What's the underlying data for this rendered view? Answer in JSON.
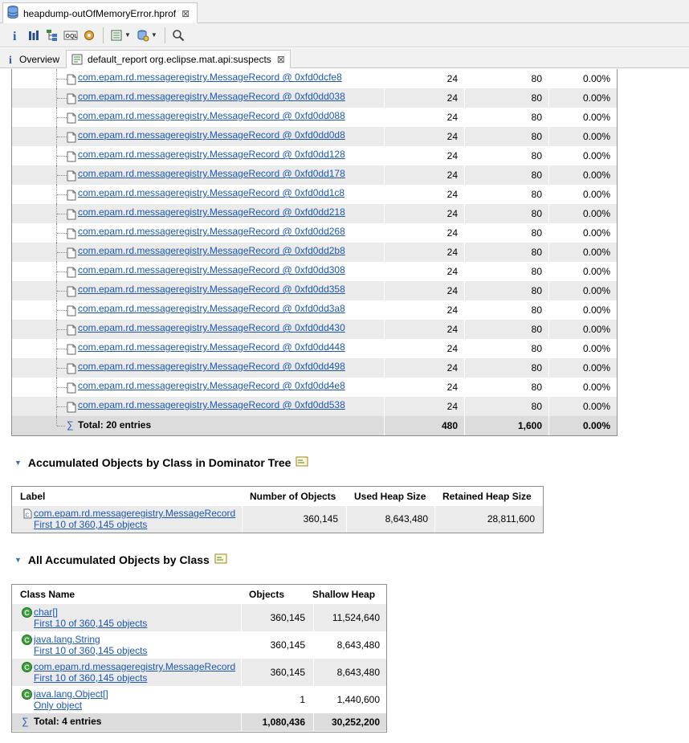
{
  "editor_tab": {
    "title": "heapdump-outOfMemoryError.hprof",
    "close": "⊠"
  },
  "toolbar": {
    "buttons": [
      "info-icon",
      "histogram-icon",
      "dominator-tree-icon",
      "oql-icon",
      "heap-dump-overview-icon",
      "query-browser-icon",
      "find-object-icon",
      "search-icon"
    ]
  },
  "inner_tabs": {
    "overview_label": "Overview",
    "report_label": "default_report  org.eclipse.mat.api:suspects",
    "report_close": "⊠"
  },
  "record_table": {
    "rows": [
      {
        "object": "com.epam.rd.messageregistry.MessageRecord @ 0xfd0dcfe8",
        "shallow": "24",
        "retained": "80",
        "percent": "0.00%"
      },
      {
        "object": "com.epam.rd.messageregistry.MessageRecord @ 0xfd0dd038",
        "shallow": "24",
        "retained": "80",
        "percent": "0.00%"
      },
      {
        "object": "com.epam.rd.messageregistry.MessageRecord @ 0xfd0dd088",
        "shallow": "24",
        "retained": "80",
        "percent": "0.00%"
      },
      {
        "object": "com.epam.rd.messageregistry.MessageRecord @ 0xfd0dd0d8",
        "shallow": "24",
        "retained": "80",
        "percent": "0.00%"
      },
      {
        "object": "com.epam.rd.messageregistry.MessageRecord @ 0xfd0dd128",
        "shallow": "24",
        "retained": "80",
        "percent": "0.00%"
      },
      {
        "object": "com.epam.rd.messageregistry.MessageRecord @ 0xfd0dd178",
        "shallow": "24",
        "retained": "80",
        "percent": "0.00%"
      },
      {
        "object": "com.epam.rd.messageregistry.MessageRecord @ 0xfd0dd1c8",
        "shallow": "24",
        "retained": "80",
        "percent": "0.00%"
      },
      {
        "object": "com.epam.rd.messageregistry.MessageRecord @ 0xfd0dd218",
        "shallow": "24",
        "retained": "80",
        "percent": "0.00%"
      },
      {
        "object": "com.epam.rd.messageregistry.MessageRecord @ 0xfd0dd268",
        "shallow": "24",
        "retained": "80",
        "percent": "0.00%"
      },
      {
        "object": "com.epam.rd.messageregistry.MessageRecord @ 0xfd0dd2b8",
        "shallow": "24",
        "retained": "80",
        "percent": "0.00%"
      },
      {
        "object": "com.epam.rd.messageregistry.MessageRecord @ 0xfd0dd308",
        "shallow": "24",
        "retained": "80",
        "percent": "0.00%"
      },
      {
        "object": "com.epam.rd.messageregistry.MessageRecord @ 0xfd0dd358",
        "shallow": "24",
        "retained": "80",
        "percent": "0.00%"
      },
      {
        "object": "com.epam.rd.messageregistry.MessageRecord @ 0xfd0dd3a8",
        "shallow": "24",
        "retained": "80",
        "percent": "0.00%"
      },
      {
        "object": "com.epam.rd.messageregistry.MessageRecord @ 0xfd0dd430",
        "shallow": "24",
        "retained": "80",
        "percent": "0.00%"
      },
      {
        "object": "com.epam.rd.messageregistry.MessageRecord @ 0xfd0dd448",
        "shallow": "24",
        "retained": "80",
        "percent": "0.00%"
      },
      {
        "object": "com.epam.rd.messageregistry.MessageRecord @ 0xfd0dd498",
        "shallow": "24",
        "retained": "80",
        "percent": "0.00%"
      },
      {
        "object": "com.epam.rd.messageregistry.MessageRecord @ 0xfd0dd4e8",
        "shallow": "24",
        "retained": "80",
        "percent": "0.00%"
      },
      {
        "object": "com.epam.rd.messageregistry.MessageRecord @ 0xfd0dd538",
        "shallow": "24",
        "retained": "80",
        "percent": "0.00%"
      }
    ],
    "total": {
      "sigma": "∑",
      "label": "Total: 20 entries",
      "shallow": "480",
      "retained": "1,600",
      "percent": "0.00%"
    }
  },
  "dominator_section": {
    "title": "Accumulated Objects by Class in Dominator Tree",
    "columns": {
      "label": "Label",
      "number": "Number of Objects",
      "used": "Used Heap Size",
      "retained": "Retained Heap Size"
    },
    "row": {
      "class": "com.epam.rd.messageregistry.MessageRecord",
      "sub": "First 10 of 360,145 objects",
      "number": "360,145",
      "used": "8,643,480",
      "retained": "28,811,600"
    }
  },
  "all_section": {
    "title": "All Accumulated Objects by Class",
    "columns": {
      "class_name": "Class Name",
      "objects": "Objects",
      "shallow": "Shallow Heap"
    },
    "rows": [
      {
        "class": "char[]",
        "sub": "First 10 of 360,145 objects",
        "objects": "360,145",
        "shallow": "11,524,640"
      },
      {
        "class": "java.lang.String",
        "sub": "First 10 of 360,145 objects",
        "objects": "360,145",
        "shallow": "8,643,480"
      },
      {
        "class": "com.epam.rd.messageregistry.MessageRecord",
        "sub": "First 10 of 360,145 objects",
        "objects": "360,145",
        "shallow": "8,643,480"
      },
      {
        "class": "java.lang.Object[]",
        "sub": "Only object",
        "objects": "1",
        "shallow": "1,440,600"
      }
    ],
    "total": {
      "sigma": "∑",
      "label": "Total: 4 entries",
      "objects": "1,080,436",
      "shallow": "30,252,200"
    }
  },
  "colors": {
    "link": "#1b57b8",
    "alt_row": "#ebebeb",
    "total_row": "#dcdcdc",
    "class_icon": "#3aa33a"
  }
}
